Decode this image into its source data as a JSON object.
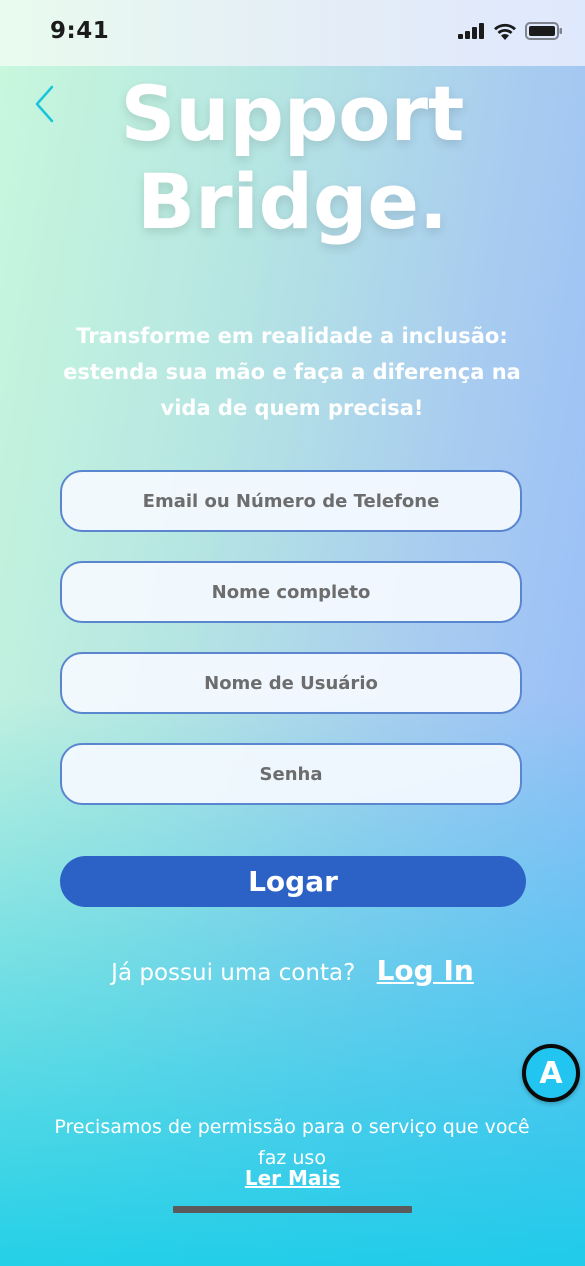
{
  "status_bar": {
    "time": "9:41"
  },
  "title": {
    "line1": "Support",
    "line2": "Bridge."
  },
  "tagline": "Transforme em realidade a inclusão: estenda sua mão e faça a diferença na vida de quem precisa!",
  "form": {
    "email_placeholder": "Email ou Número de Telefone",
    "name_placeholder": "Nome completo",
    "username_placeholder": "Nome de Usuário",
    "password_placeholder": "Senha",
    "submit_label": "Logar"
  },
  "account": {
    "question": "Já possui uma conta?",
    "link": "Log In"
  },
  "accessibility_badge": "A",
  "permission": {
    "text": "Precisamos de permissão para o serviço que você faz uso",
    "link": "Ler Mais"
  },
  "colors": {
    "primary_button": "#2c62c6",
    "field_border": "#5a86cf",
    "badge": "#21c5f0"
  }
}
